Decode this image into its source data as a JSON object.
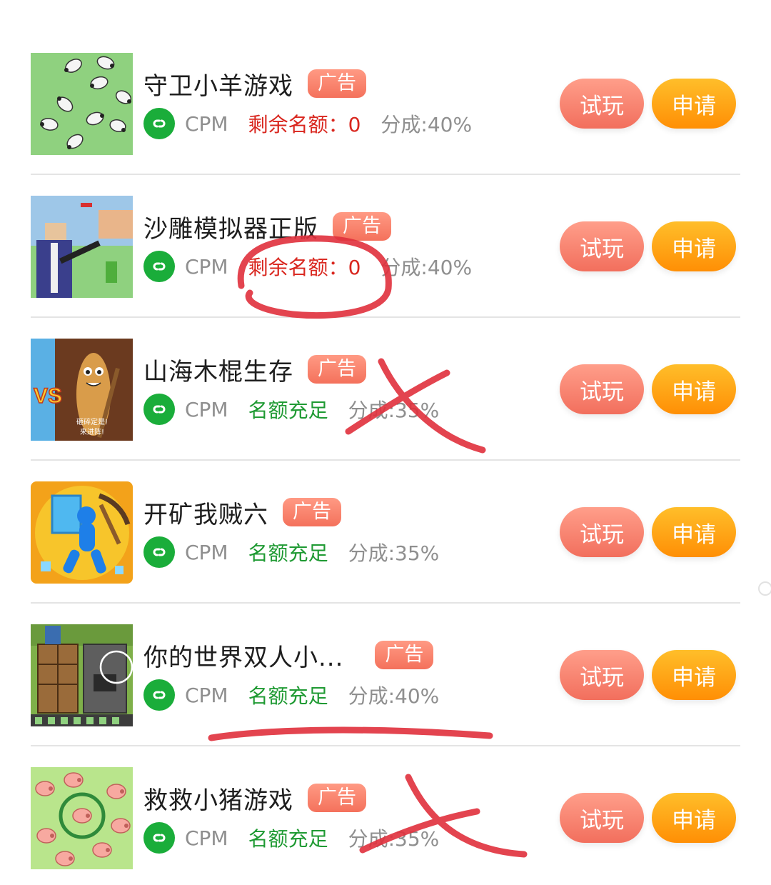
{
  "games": [
    {
      "title": "守卫小羊游戏",
      "ad": "广告",
      "type": "CPM",
      "quota": "剩余名额：0",
      "quota_status": "red",
      "share": "分成:40%",
      "try_label": "试玩",
      "apply_label": "申请"
    },
    {
      "title": "沙雕模拟器正版",
      "ad": "广告",
      "type": "CPM",
      "quota": "剩余名额：0",
      "quota_status": "red",
      "share": "分成:40%",
      "try_label": "试玩",
      "apply_label": "申请"
    },
    {
      "title": "山海木棍生存",
      "ad": "广告",
      "type": "CPM",
      "quota": "名额充足",
      "quota_status": "green",
      "share": "分成:35%",
      "try_label": "试玩",
      "apply_label": "申请"
    },
    {
      "title": "开矿我贼六",
      "ad": "广告",
      "type": "CPM",
      "quota": "名额充足",
      "quota_status": "green",
      "share": "分成:35%",
      "try_label": "试玩",
      "apply_label": "申请"
    },
    {
      "title": "你的世界双人小...",
      "ad": "广告",
      "type": "CPM",
      "quota": "名额充足",
      "quota_status": "green",
      "share": "分成:40%",
      "try_label": "试玩",
      "apply_label": "申请"
    },
    {
      "title": "救救小猪游戏",
      "ad": "广告",
      "type": "CPM",
      "quota": "名额充足",
      "quota_status": "green",
      "share": "分成:35%",
      "try_label": "试玩",
      "apply_label": "申请"
    }
  ],
  "thumb_text": {
    "g3_line1": "砸碎定是!",
    "g3_line2": "来进阵!",
    "g3_vs": "VS"
  },
  "colors": {
    "ad_badge": "#f4715c",
    "try": "#f26f5d",
    "apply": "#ff8f05",
    "quota_red": "#d9271f",
    "quota_green": "#1f9a33",
    "annotation": "#e0303c"
  }
}
